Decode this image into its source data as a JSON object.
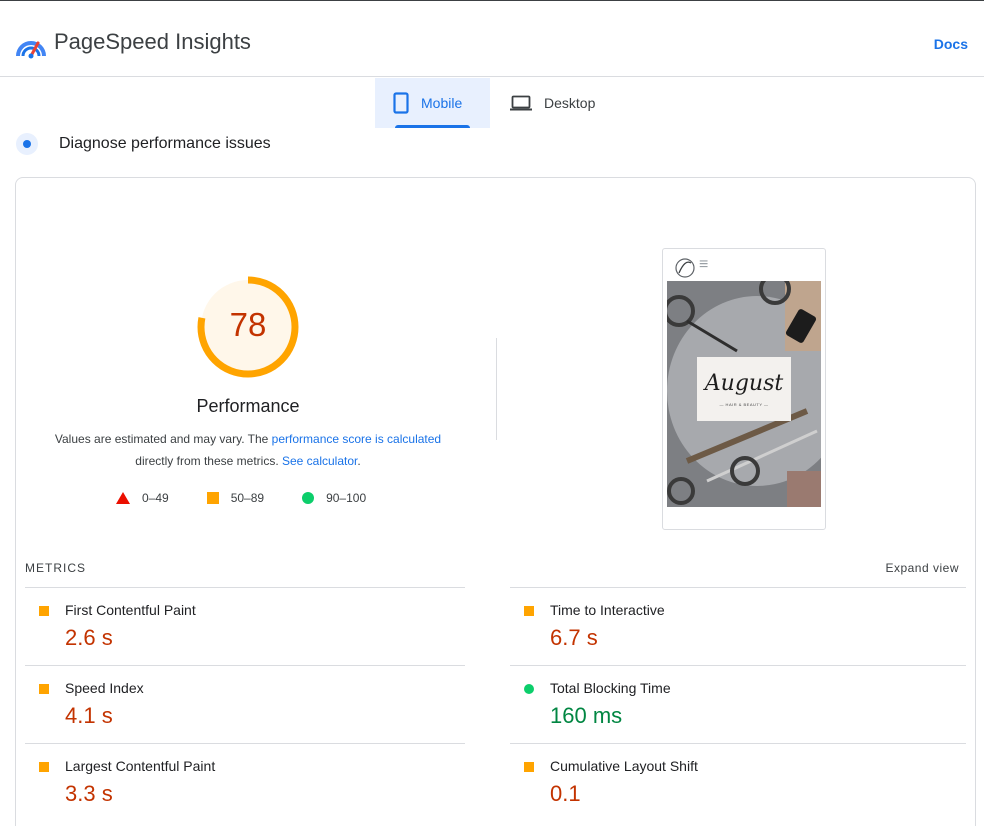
{
  "header": {
    "app_title": "PageSpeed Insights",
    "docs_label": "Docs",
    "logo_icon": "pagespeed-gauge-icon"
  },
  "tabs": [
    {
      "label": "Mobile",
      "icon": "smartphone-icon",
      "active": true
    },
    {
      "label": "Desktop",
      "icon": "laptop-icon",
      "active": false
    }
  ],
  "diagnose": {
    "label": "Diagnose performance issues",
    "icon": "diagnose-dot-icon"
  },
  "score": {
    "value": 78,
    "fraction": 0.78,
    "label": "Performance",
    "color": "#ffa400",
    "text_color": "#c33300"
  },
  "note": {
    "prefix": "Values are estimated and may vary. The ",
    "link1": "performance score is calculated",
    "middle": "directly from these metrics. ",
    "link2": "See calculator",
    "suffix": "."
  },
  "legend": [
    {
      "range": "0–49",
      "shape": "triangle",
      "color": "#eb0f00"
    },
    {
      "range": "50–89",
      "shape": "square",
      "color": "#ffa400"
    },
    {
      "range": "90–100",
      "shape": "circle",
      "color": "#0cce6b"
    }
  ],
  "screenshot": {
    "brand": "August",
    "tagline": "— HAIR & BEAUTY —",
    "menu_icon": "hamburger-menu-icon"
  },
  "metrics": {
    "title": "METRICS",
    "expand_label": "Expand view",
    "items": [
      {
        "label": "First Contentful Paint",
        "value": "2.6 s",
        "rating": "average"
      },
      {
        "label": "Time to Interactive",
        "value": "6.7 s",
        "rating": "average"
      },
      {
        "label": "Speed Index",
        "value": "4.1 s",
        "rating": "average"
      },
      {
        "label": "Total Blocking Time",
        "value": "160 ms",
        "rating": "good"
      },
      {
        "label": "Largest Contentful Paint",
        "value": "3.3 s",
        "rating": "average"
      },
      {
        "label": "Cumulative Layout Shift",
        "value": "0.1",
        "rating": "average"
      }
    ]
  }
}
